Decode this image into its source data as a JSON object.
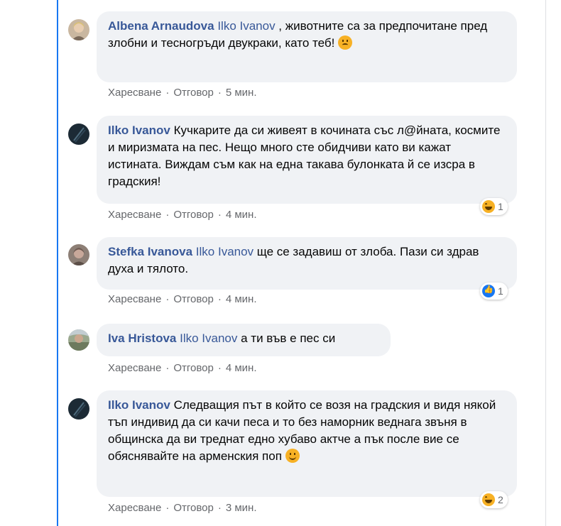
{
  "comments": [
    {
      "author": "Albena Arnaudova",
      "mention": "Ilko Ivanov",
      "text": " , животните са за предпочитане пред злобни и тесногръди двукраки, като теб!",
      "emoji": "angry-face-icon",
      "like": "Харесване",
      "reply": "Отговор",
      "time": "5 мин."
    },
    {
      "author": "Ilko Ivanov",
      "text": "Кучкарите да си живеят в кочината със л@йната, космите и миризмата на пес. Нещо много сте обидчиви като ви кажат истината. Виждам съм как на една такава булонката й се изсра в градския!",
      "like": "Харесване",
      "reply": "Отговор",
      "time": "4 мин.",
      "reaction": {
        "icon": "haha-icon",
        "count": "1"
      }
    },
    {
      "author": "Stefka Ivanova",
      "mention": "Ilko Ivanov",
      "text": " ще се задавиш от злоба. Пази си здрав духа и тялото.",
      "like": "Харесване",
      "reply": "Отговор",
      "time": "4 мин.",
      "reaction": {
        "icon": "like-icon",
        "count": "1"
      }
    },
    {
      "author": "Iva Hristova",
      "mention": "Ilko Ivanov",
      "text": " а ти във е пес си",
      "like": "Харесване",
      "reply": "Отговор",
      "time": "4 мин."
    },
    {
      "author": "Ilko Ivanov",
      "text": "Следващия път в който се возя на градския и видя някой тъп индивид да си качи песа и то без наморник веднага звъня в общинска да ви треднат едно хубаво актче а пък после вие се обяснявайте на арменския поп",
      "emoji": "smiling-face-icon",
      "like": "Харесване",
      "reply": "Отговор",
      "time": "3 мин.",
      "reaction": {
        "icon": "haha-icon",
        "count": "2"
      }
    }
  ],
  "separator": "·",
  "colors": {
    "author": "#385898",
    "bubble": "#f0f2f5",
    "meta": "#65676b",
    "accent": "#1877f2"
  }
}
